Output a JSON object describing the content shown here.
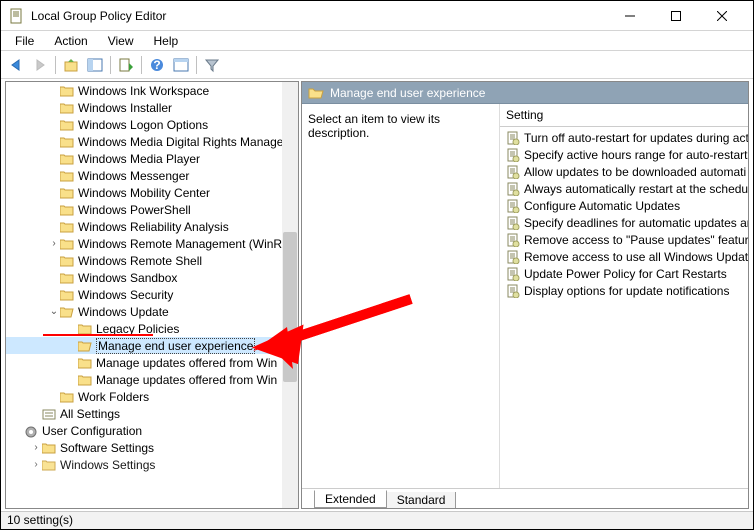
{
  "window": {
    "title": "Local Group Policy Editor"
  },
  "menubar": [
    "File",
    "Action",
    "View",
    "Help"
  ],
  "tree": {
    "items": [
      {
        "indent": 2,
        "caret": "",
        "icon": "folder",
        "label": "Windows Ink Workspace"
      },
      {
        "indent": 2,
        "caret": "",
        "icon": "folder",
        "label": "Windows Installer"
      },
      {
        "indent": 2,
        "caret": "",
        "icon": "folder",
        "label": "Windows Logon Options"
      },
      {
        "indent": 2,
        "caret": "",
        "icon": "folder",
        "label": "Windows Media Digital Rights Manage"
      },
      {
        "indent": 2,
        "caret": "",
        "icon": "folder",
        "label": "Windows Media Player"
      },
      {
        "indent": 2,
        "caret": "",
        "icon": "folder",
        "label": "Windows Messenger"
      },
      {
        "indent": 2,
        "caret": "",
        "icon": "folder",
        "label": "Windows Mobility Center"
      },
      {
        "indent": 2,
        "caret": "",
        "icon": "folder",
        "label": "Windows PowerShell"
      },
      {
        "indent": 2,
        "caret": "",
        "icon": "folder",
        "label": "Windows Reliability Analysis"
      },
      {
        "indent": 2,
        "caret": ">",
        "icon": "folder",
        "label": "Windows Remote Management (WinR"
      },
      {
        "indent": 2,
        "caret": "",
        "icon": "folder",
        "label": "Windows Remote Shell"
      },
      {
        "indent": 2,
        "caret": "",
        "icon": "folder",
        "label": "Windows Sandbox"
      },
      {
        "indent": 2,
        "caret": "",
        "icon": "folder",
        "label": "Windows Security"
      },
      {
        "indent": 2,
        "caret": "v",
        "icon": "folder-open",
        "label": "Windows Update",
        "underline": true
      },
      {
        "indent": 3,
        "caret": "",
        "icon": "folder",
        "label": "Legacy Policies"
      },
      {
        "indent": 3,
        "caret": "",
        "icon": "folder-open",
        "label": "Manage end user experience",
        "selected": true
      },
      {
        "indent": 3,
        "caret": "",
        "icon": "folder",
        "label": "Manage updates offered from Win"
      },
      {
        "indent": 3,
        "caret": "",
        "icon": "folder",
        "label": "Manage updates offered from Win"
      },
      {
        "indent": 2,
        "caret": "",
        "icon": "folder",
        "label": "Work Folders"
      },
      {
        "indent": 1,
        "caret": "",
        "icon": "settings",
        "label": "All Settings"
      },
      {
        "indent": 0,
        "caret": "",
        "icon": "gear",
        "label": "User Configuration"
      },
      {
        "indent": 1,
        "caret": ">",
        "icon": "folder",
        "label": "Software Settings"
      },
      {
        "indent": 1,
        "caret": ">",
        "icon": "folder",
        "label": "Windows Settings",
        "cut": true
      }
    ]
  },
  "right": {
    "header_label": "Manage end user experience",
    "description": "Select an item to view its description.",
    "setting_header": "Setting",
    "settings": [
      "Turn off auto-restart for updates during act",
      "Specify active hours range for auto-restarts",
      "Allow updates to be downloaded automati",
      "Always automatically restart at the schedul",
      "Configure Automatic Updates",
      "Specify deadlines for automatic updates an",
      "Remove access to \"Pause updates\" feature",
      "Remove access to use all Windows Update",
      "Update Power Policy for Cart Restarts",
      "Display options for update notifications"
    ]
  },
  "tabs": {
    "extended": "Extended",
    "standard": "Standard"
  },
  "statusbar": {
    "count": "10 setting(s)"
  }
}
